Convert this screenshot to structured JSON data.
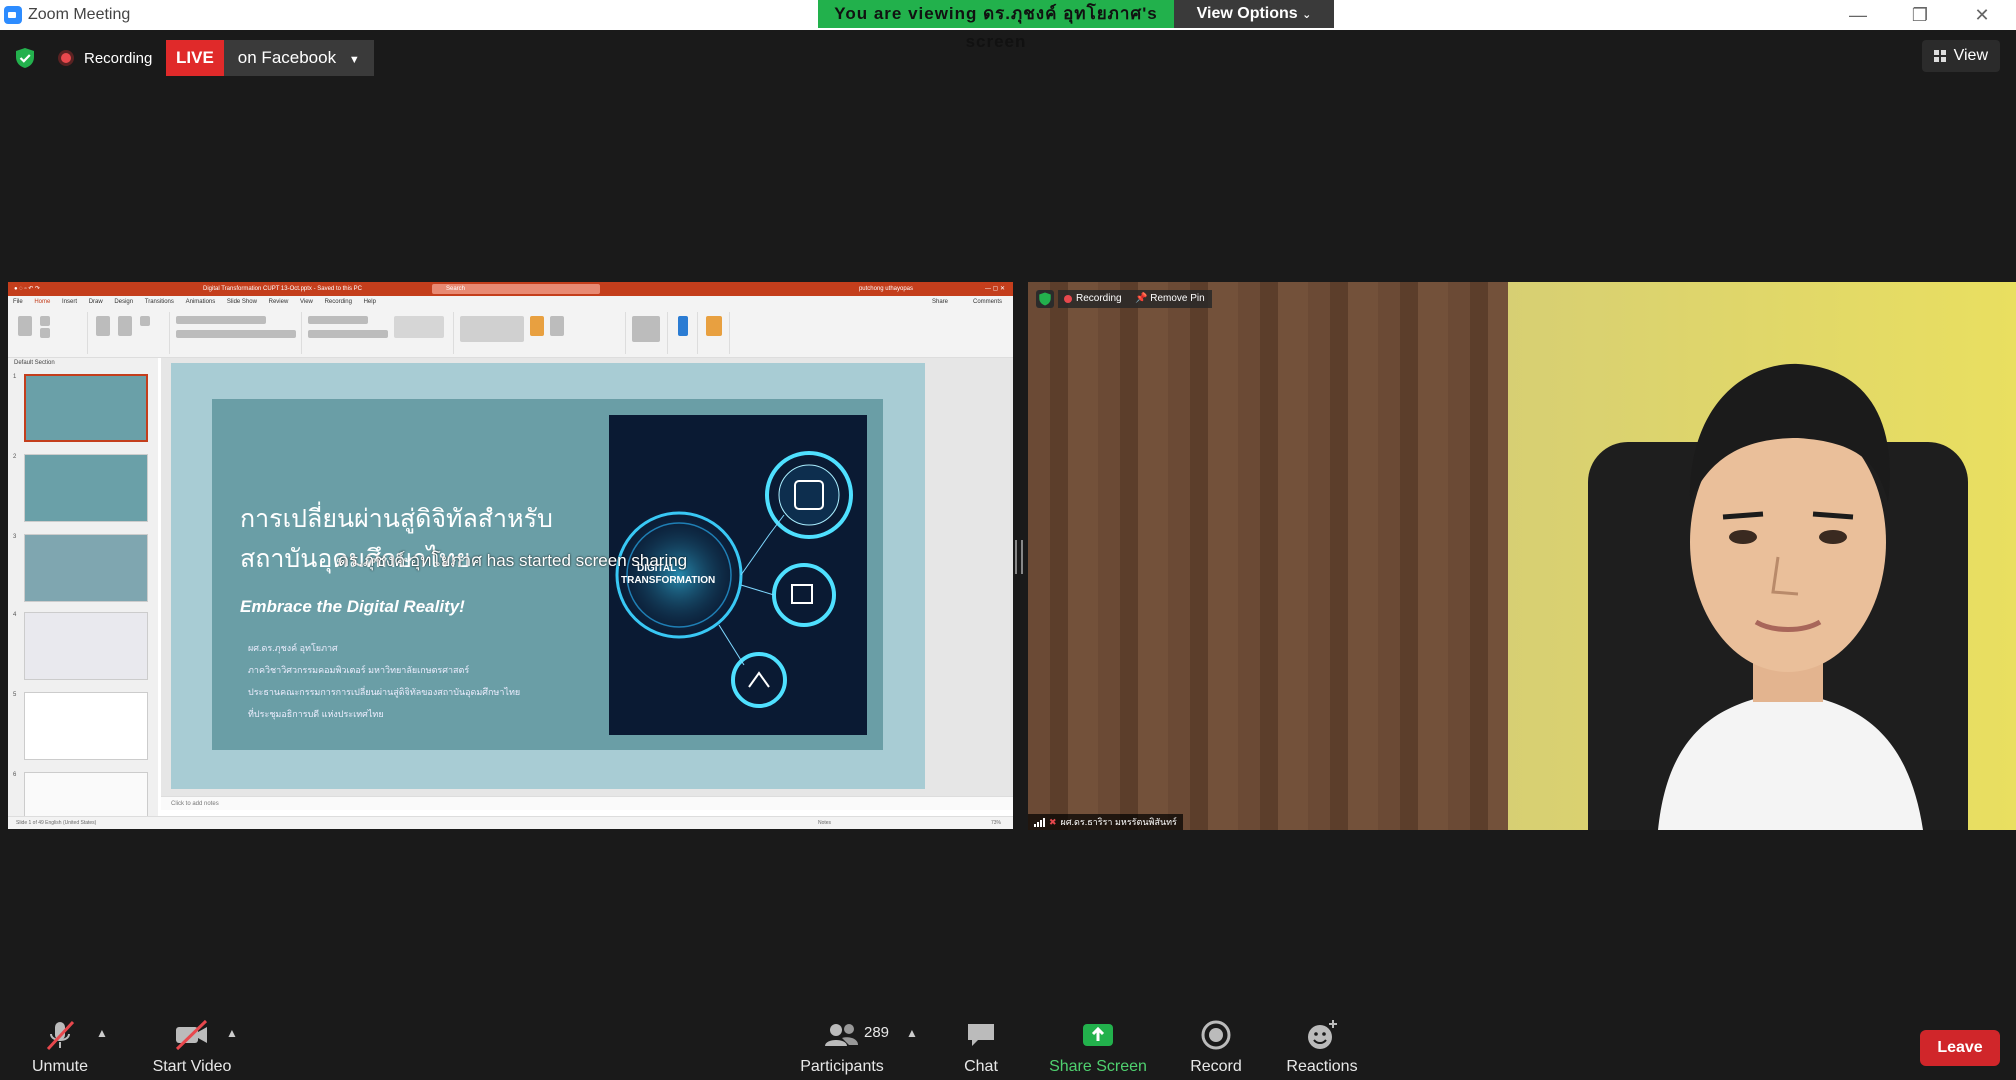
{
  "window": {
    "title": "Zoom Meeting",
    "viewing_banner": "You are viewing ดร.ภุชงค์ อุทโยภาศ's screen",
    "view_options": "View Options",
    "minimize": "—",
    "restore": "❐",
    "close": "✕"
  },
  "status": {
    "recording": "Recording",
    "live": "LIVE",
    "live_target": "on Facebook",
    "view": "View"
  },
  "share": {
    "overlay_text": "ดร.ภุชงค์ อุทโยภาศ has started screen sharing",
    "ppt": {
      "doc_title": "Digital Transformation CUPT 13-Oct.pptx - Saved to this PC",
      "search": "Search",
      "user": "putchong uthayopas",
      "menu": [
        "File",
        "Home",
        "Insert",
        "Draw",
        "Design",
        "Transitions",
        "Animations",
        "Slide Show",
        "Review",
        "View",
        "Recording",
        "Help"
      ],
      "share_btn": "Share",
      "comments_btn": "Comments",
      "section_label": "Default Section",
      "thumb_numbers": [
        "1",
        "2",
        "3",
        "4",
        "5",
        "6"
      ],
      "notes_placeholder": "Click to add notes",
      "status_left": "Slide 1 of 49    English (United States)",
      "status_right": "Notes",
      "zoom": "73%"
    },
    "slide": {
      "title_line1": "การเปลี่ยนผ่านสู่ดิจิทัลสำหรับ",
      "title_line2": "สถาบันอุดมศึกษาไทย",
      "subtitle": "Embrace the Digital Reality!",
      "lines": [
        "ผศ.ดร.ภุชงค์ อุทโยภาศ",
        "ภาควิชาวิศวกรรมคอมพิวเตอร์ มหาวิทยาลัยเกษตรศาสตร์",
        "ประธานคณะกรรมการการเปลี่ยนผ่านสู่ดิจิทัลของสถาบันอุดมศึกษาไทย",
        "ที่ประชุมอธิการบดี แห่งประเทศไทย"
      ],
      "image_text_line1": "DIGITAL",
      "image_text_line2": "TRANSFORMATION"
    }
  },
  "video": {
    "recording": "Recording",
    "remove_pin": "Remove Pin",
    "participant_name": "ผศ.ดร.ธาริรา มหรรัตนพิสันทร์"
  },
  "toolbar": {
    "unmute": "Unmute",
    "start_video": "Start Video",
    "participants": "Participants",
    "participant_count": "289",
    "chat": "Chat",
    "share_screen": "Share Screen",
    "record": "Record",
    "reactions": "Reactions",
    "leave": "Leave"
  },
  "colors": {
    "live_red": "#e02a2a",
    "banner_green": "#22b14c",
    "share_green": "#22b14c",
    "leave_red": "#d0262a",
    "ppt_orange": "#c43e1c"
  }
}
